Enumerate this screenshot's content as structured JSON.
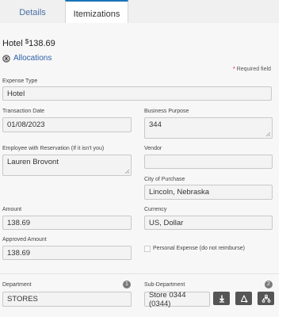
{
  "tabs": [
    {
      "label": "Details"
    },
    {
      "label": "Itemizations"
    }
  ],
  "header": {
    "title": "Hotel",
    "currency_symbol": "$",
    "amount": "138.69"
  },
  "allocations_link": "Allocations",
  "required_note": "Required field",
  "fields": {
    "expense_type": {
      "label": "Expense Type",
      "value": "Hotel"
    },
    "transaction_date": {
      "label": "Transaction Date",
      "value": "01/08/2023"
    },
    "business_purpose": {
      "label": "Business Purpose",
      "value": "344"
    },
    "employee_with_reservation": {
      "label": "Employee with Reservation (If it isn't you)",
      "value": "Lauren Brovont"
    },
    "vendor": {
      "label": "Vendor",
      "value": ""
    },
    "city_of_purchase": {
      "label": "City of Purchase",
      "value": "Lincoln, Nebraska"
    },
    "amount": {
      "label": "Amount",
      "value": "138.69"
    },
    "currency": {
      "label": "Currency",
      "value": "US, Dollar"
    },
    "approved_amount": {
      "label": "Approved Amount",
      "value": "138.69"
    },
    "personal_expense": {
      "label": "Personal Expense (do not reimburse)",
      "checked": false
    },
    "department": {
      "label": "Department",
      "badge": "1",
      "value": "STORES"
    },
    "sub_department": {
      "label": "Sub-Department",
      "badge": "2",
      "value": "Store 0344 (0344)"
    }
  },
  "icons": {
    "allocations": "globe-icon",
    "download": "download-icon",
    "add_filter": "filter-plus-icon",
    "hierarchy": "hierarchy-icon"
  },
  "colors": {
    "link": "#2a5ea8",
    "tab_active_border": "#1a73b8",
    "required_star": "#d0021b",
    "action_button": "#555555",
    "badge": "#7a7a7a"
  }
}
